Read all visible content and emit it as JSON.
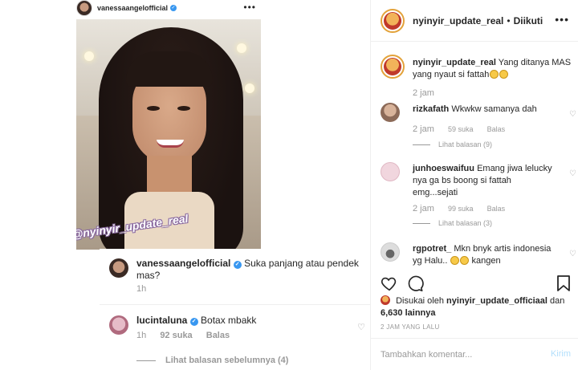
{
  "left_post": {
    "header": {
      "username": "vanessaangelofficial",
      "more": "•••"
    },
    "photo": {
      "watermark": "@nyinyir_update_real"
    },
    "comment1": {
      "username": "vanessaangelofficial",
      "text": "Suka panjang atau pendek mas?",
      "time": "1h"
    },
    "comment2": {
      "username": "lucintaluna",
      "text": "Botax mbakk",
      "time": "1h",
      "likes": "92 suka",
      "reply": "Balas",
      "view_replies": "Lihat balasan sebelumnya (4)"
    }
  },
  "right_panel": {
    "header": {
      "username": "nyinyir_update_real",
      "dot": "•",
      "follow_status": "Diikuti",
      "more": "•••"
    },
    "caption": {
      "username": "nyinyir_update_real",
      "text": "Yang ditanya MAS yang nyaut si fattah",
      "time": "2 jam"
    },
    "comments": [
      {
        "username": "rizkafath",
        "text": "Wkwkw samanya dah",
        "time": "2 jam",
        "likes": "59 suka",
        "reply": "Balas",
        "replies": "Lihat balasan (9)"
      },
      {
        "username": "junhoeswaifuu",
        "text": "Emang jiwa lelucky nya ga bs boong si fattah emg...sejati",
        "time": "2 jam",
        "likes": "99 suka",
        "reply": "Balas",
        "replies": "Lihat balasan (3)"
      },
      {
        "username": "rgpotret_",
        "text": "Mkn bnyk artis indonesia yg Halu..",
        "text_after": "kangen"
      }
    ],
    "likes_line": {
      "prefix": "Disukai oleh",
      "user": "nyinyir_update_officiaal",
      "suffix": "dan",
      "others": "6,630 lainnya"
    },
    "time_ago": "2 JAM YANG LALU",
    "input": {
      "placeholder": "Tambahkan komentar...",
      "send": "Kirim"
    }
  },
  "colors": {
    "verified": "#3897f0",
    "muted": "#999999",
    "send_disabled": "#b2dffc",
    "text": "#262626"
  }
}
